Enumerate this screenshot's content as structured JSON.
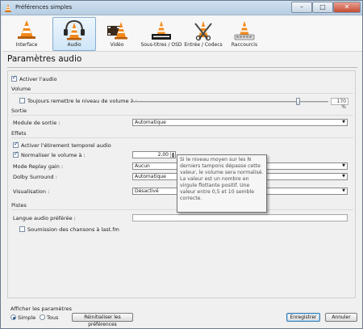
{
  "window": {
    "title": "Préférences simples",
    "close_label": "✕",
    "min_label": "–",
    "max_label": "□"
  },
  "toolbar": {
    "items": [
      {
        "label": "Interface",
        "icon": "interface-icon",
        "selected": false
      },
      {
        "label": "Audio",
        "icon": "audio-headphones-icon",
        "selected": true
      },
      {
        "label": "Vidéo",
        "icon": "video-icon",
        "selected": false
      },
      {
        "label": "Sous-titres / OSD",
        "icon": "subtitles-icon",
        "selected": false
      },
      {
        "label": "Entrée / Codecs",
        "icon": "codecs-icon",
        "selected": false
      },
      {
        "label": "Raccourcis",
        "icon": "hotkeys-icon",
        "selected": false
      }
    ]
  },
  "page": {
    "heading": "Paramètres audio"
  },
  "audio": {
    "enable_label": "Activer l'audio",
    "enable_checked": true,
    "volume": {
      "section": "Volume",
      "reset_label": "Toujours remettre le niveau de volume à :",
      "reset_checked": false,
      "percent": "170 %",
      "slider_percent": 85
    },
    "output": {
      "section": "Sortie",
      "module_label": "Module de sortie :",
      "module_value": "Automatique"
    },
    "effects": {
      "section": "Effets",
      "stretch_label": "Activer l'étirement temporel audio",
      "stretch_checked": true,
      "normalize_label": "Normaliser le volume à :",
      "normalize_checked": true,
      "normalize_value": "2,00",
      "replaygain_label": "Mode Replay gain :",
      "replaygain_value": "Aucun",
      "dolby_label": "Dolby Surround :",
      "dolby_value": "Automatique",
      "visual_label": "Visualisation :",
      "visual_value": "Désactivé"
    },
    "tracks": {
      "section": "Pistes",
      "lang_label": "Langue audio préférée :",
      "lang_value": "",
      "lastfm_label": "Soumission des chansons à last.fm",
      "lastfm_checked": false
    }
  },
  "tooltip": {
    "text": "Si le niveau moyen sur les N derniers tampons dépasse cette valeur, le volume sera normalisé. La valeur est un nombre en virgule flottante positif. Une valeur entre 0,5 et 10 semble correcte."
  },
  "footer": {
    "show_settings_label": "Afficher les paramètres",
    "simple_label": "Simple",
    "all_label": "Tous",
    "simple_selected": true,
    "reset_button": "Réinitialiser les préférences",
    "save_button": "Enregistrer",
    "cancel_button": "Annuler"
  }
}
